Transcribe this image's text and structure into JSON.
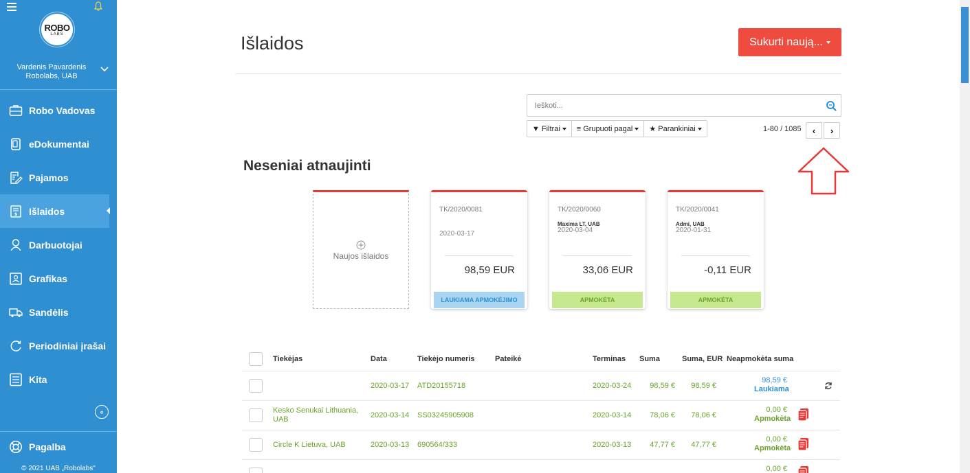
{
  "sidebar": {
    "logo": {
      "main": "ROBO",
      "sub": "LABS"
    },
    "user": {
      "name": "Vardenis Pavardenis",
      "company": "Robolabs, UAB"
    },
    "items": [
      {
        "label": "Robo Vadovas",
        "icon": "briefcase-icon"
      },
      {
        "label": "eDokumentai",
        "icon": "documents-icon"
      },
      {
        "label": "Pajamos",
        "icon": "invoice-edit-icon"
      },
      {
        "label": "Išlaidos",
        "icon": "expense-doc-icon",
        "active": true
      },
      {
        "label": "Darbuotojai",
        "icon": "employee-icon"
      },
      {
        "label": "Grafikas",
        "icon": "schedule-icon"
      },
      {
        "label": "Sandėlis",
        "icon": "truck-icon"
      },
      {
        "label": "Periodiniai įrašai",
        "icon": "recurring-icon"
      },
      {
        "label": "Kita",
        "icon": "other-icon"
      }
    ],
    "help": "Pagalba",
    "copyright": "© 2021 UAB „Robolabs\""
  },
  "header": {
    "title": "Išlaidos",
    "create_label": "Sukurti naują..."
  },
  "search": {
    "placeholder": "Ieškoti..."
  },
  "filters": {
    "filters_label": "Filtrai",
    "group_label": "Grupuoti pagal",
    "favorites_label": "Parankiniai"
  },
  "pager": {
    "text": "1-80 / 1085"
  },
  "recent": {
    "title": "Neseniai atnaujinti",
    "new_label": "Naujos išlaidos",
    "cards": [
      {
        "number": "TK/2020/0081",
        "supplier": "",
        "date": "2020-03-17",
        "amount": "98,59 EUR",
        "status": "LAUKIAMA APMOKĖJIMO",
        "status_type": "pending"
      },
      {
        "number": "TK/2020/0060",
        "supplier": "Maxima LT, UAB",
        "date": "2020-03-04",
        "amount": "33,06 EUR",
        "status": "APMOKĖTA",
        "status_type": "paid"
      },
      {
        "number": "TK/2020/0041",
        "supplier": "Admi, UAB",
        "date": "2020-01-31",
        "amount": "-0,11 EUR",
        "status": "APMOKĖTA",
        "status_type": "paid"
      }
    ]
  },
  "table": {
    "headers": {
      "supplier": "Tiekėjas",
      "date": "Data",
      "supplier_number": "Tiekėjo numeris",
      "note": "Pateikė",
      "term": "Terminas",
      "sum": "Suma",
      "sum_eur": "Suma, EUR",
      "unpaid": "Neapmokėta suma"
    },
    "rows": [
      {
        "supplier": "",
        "date": "2020-03-17",
        "number": "ATD20155718",
        "term": "2020-03-24",
        "sum": "98,59 €",
        "sum_eur": "98,59 €",
        "unpaid": "98,59 €",
        "unpaid_status": "Laukiama",
        "status_type": "pending",
        "has_doc": false,
        "has_refresh": true
      },
      {
        "supplier": "Kesko Senukai Lithuania, UAB",
        "date": "2020-03-14",
        "number": "SS03245905908",
        "term": "2020-03-14",
        "sum": "78,06 €",
        "sum_eur": "78,06 €",
        "unpaid": "0,00 €",
        "unpaid_status": "Apmokėta",
        "status_type": "paid",
        "has_doc": true,
        "has_refresh": false
      },
      {
        "supplier": "Circle K Lietuva, UAB",
        "date": "2020-03-13",
        "number": "690564/333",
        "term": "2020-03-13",
        "sum": "47,77 €",
        "sum_eur": "47,77 €",
        "unpaid": "0,00 €",
        "unpaid_status": "Apmokėta",
        "status_type": "paid",
        "has_doc": true,
        "has_refresh": false
      },
      {
        "supplier": "",
        "date": "",
        "number": "",
        "term": "",
        "sum": "",
        "sum_eur": "",
        "unpaid": "0,00 €",
        "unpaid_status": "",
        "status_type": "paid",
        "has_doc": true,
        "has_refresh": false
      }
    ]
  },
  "colors": {
    "sidebar": "#2f8fd0",
    "sidebar_active": "#4aa3df",
    "accent_red": "#ef4b3f",
    "paid_green": "#6aa32a",
    "pending_blue": "#2f8fd0"
  }
}
